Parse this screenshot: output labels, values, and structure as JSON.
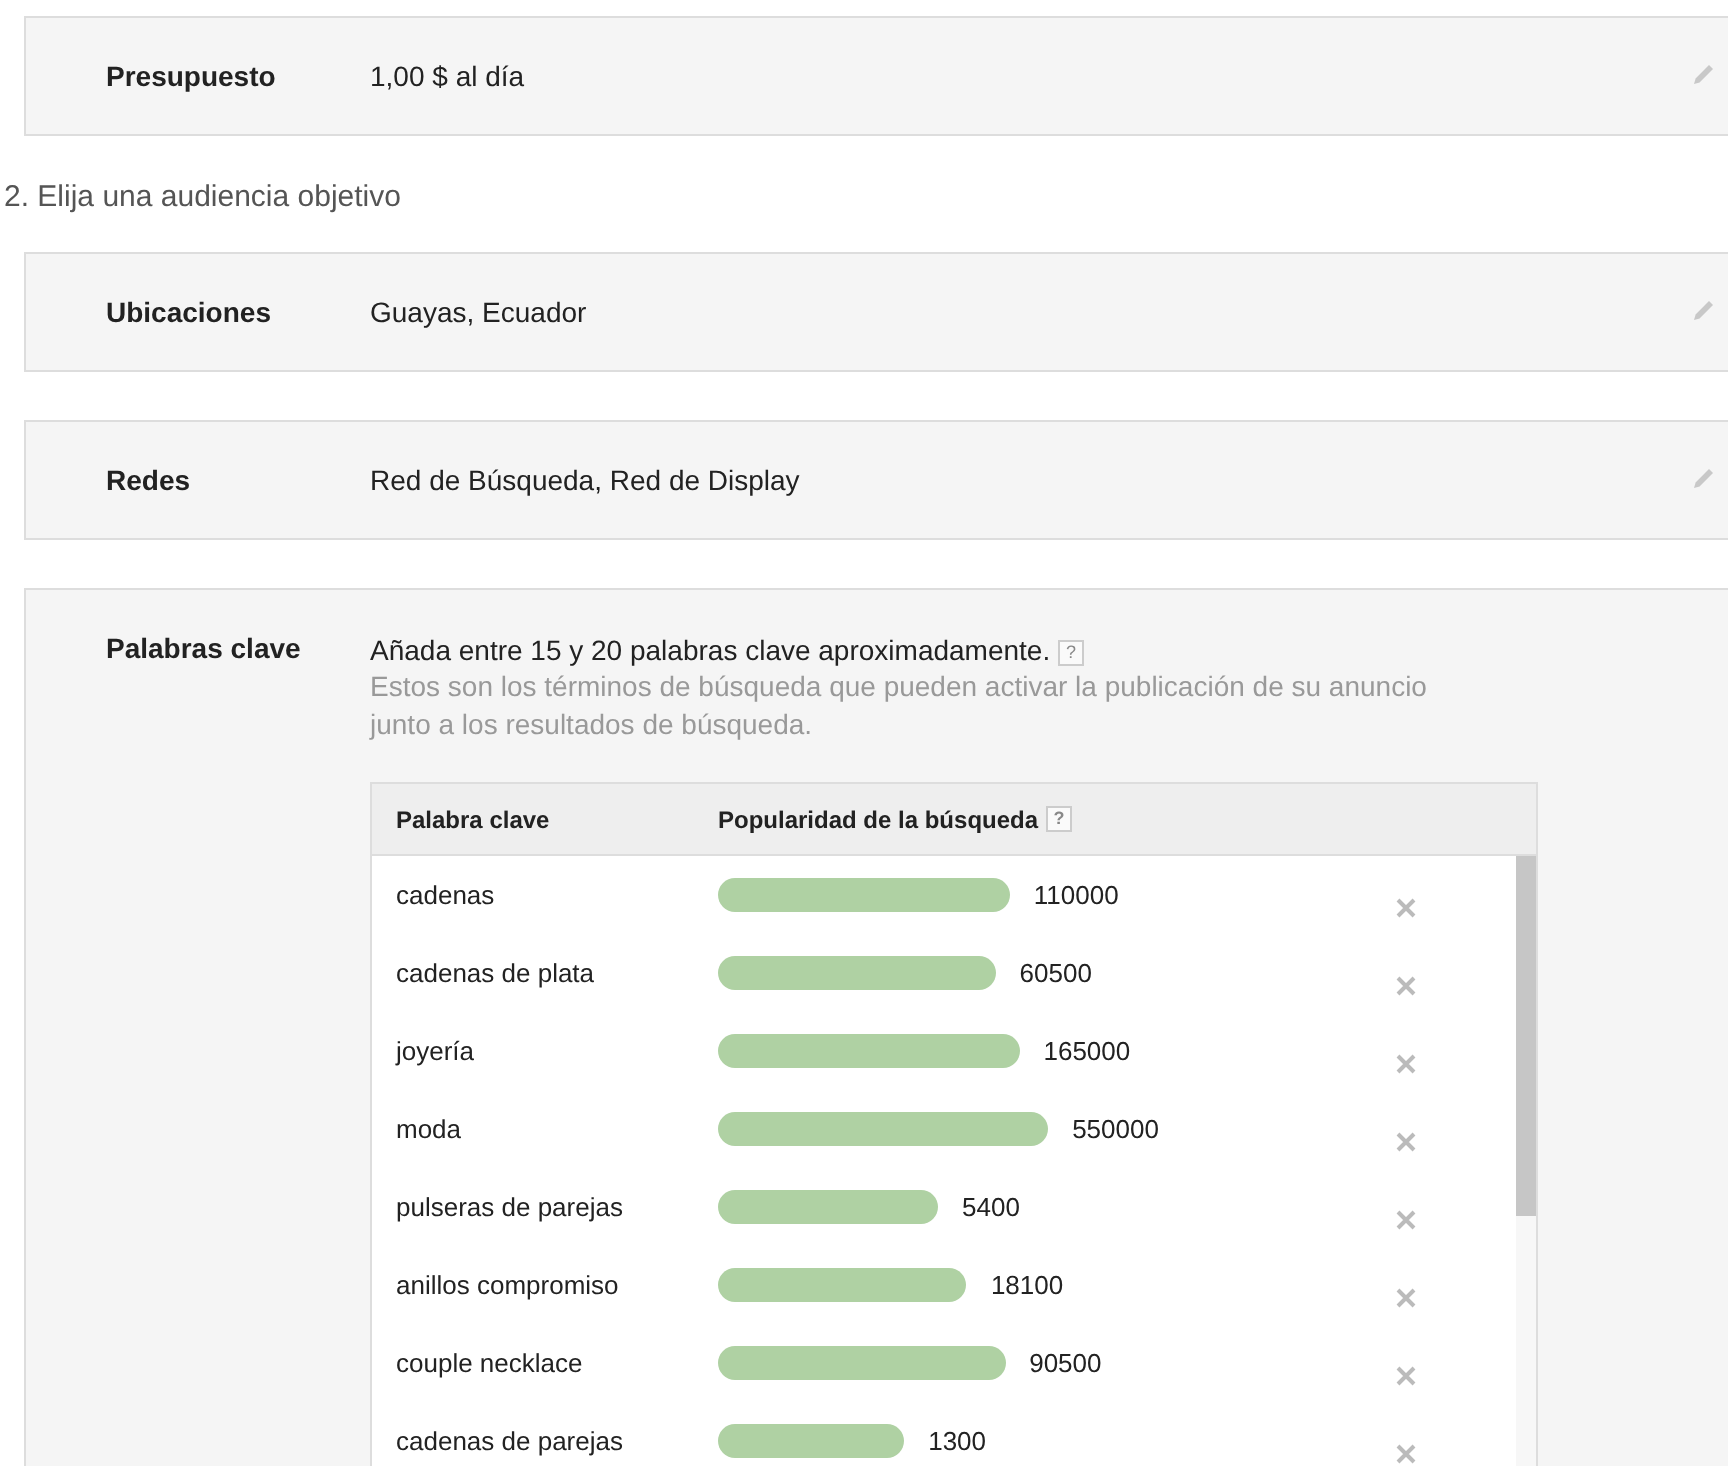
{
  "sections_top": [
    {
      "label": "Presupuesto",
      "value": "1,00 $ al día"
    }
  ],
  "heading": "2. Elija una audiencia objetivo",
  "sections": [
    {
      "label": "Ubicaciones",
      "value": "Guayas, Ecuador"
    },
    {
      "label": "Redes",
      "value": "Red de Búsqueda, Red de Display"
    }
  ],
  "keywords": {
    "label": "Palabras clave",
    "instruction": "Añada entre 15 y 20 palabras clave aproximadamente.",
    "help": "?",
    "description": "Estos son los términos de búsqueda que pueden activar la publicación de su anuncio junto a los resultados de búsqueda.",
    "table": {
      "columns": [
        {
          "label": "Palabra clave"
        },
        {
          "label": "Popularidad de la búsqueda",
          "help": "?"
        }
      ],
      "rows": [
        {
          "keyword": "cadenas",
          "count": "110000"
        },
        {
          "keyword": "cadenas de plata",
          "count": "60500"
        },
        {
          "keyword": "joyería",
          "count": "165000"
        },
        {
          "keyword": "moda",
          "count": "550000"
        },
        {
          "keyword": "pulseras de parejas",
          "count": "5400"
        },
        {
          "keyword": "anillos compromiso",
          "count": "18100"
        },
        {
          "keyword": "couple necklace",
          "count": "90500"
        },
        {
          "keyword": "cadenas de parejas",
          "count": "1300"
        }
      ]
    }
  }
}
